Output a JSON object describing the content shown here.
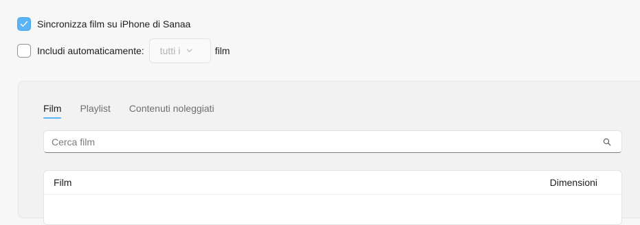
{
  "sync": {
    "checked": true,
    "label": "Sincronizza film su iPhone di Sanaa"
  },
  "include": {
    "checked": false,
    "label": "Includi automaticamente:",
    "select_value": "tutti i",
    "suffix": "film"
  },
  "tabs": [
    {
      "label": "Film",
      "active": true
    },
    {
      "label": "Playlist",
      "active": false
    },
    {
      "label": "Contenuti noleggiati",
      "active": false
    }
  ],
  "search": {
    "placeholder": "Cerca film",
    "icon": "magnifier-icon"
  },
  "table": {
    "columns": [
      "Film",
      "Dimensioni"
    ]
  },
  "colors": {
    "accent": "#5ab4f5",
    "background": "#f7f7f7"
  }
}
